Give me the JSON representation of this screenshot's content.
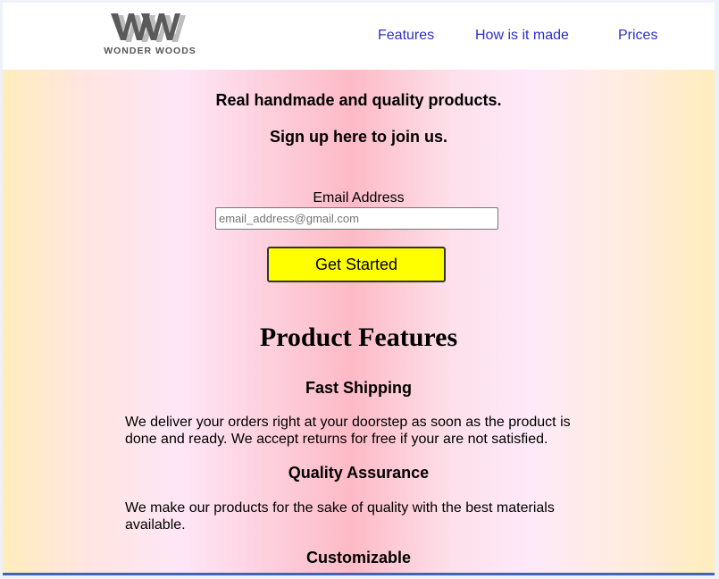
{
  "header": {
    "logo_text": "WONDER WOODS",
    "logo_monogram": "WW",
    "nav": [
      {
        "label": "Features"
      },
      {
        "label": "How is it made"
      },
      {
        "label": "Prices"
      }
    ]
  },
  "hero": {
    "tagline": "Real handmade and quality products.",
    "signup_text": "Sign up here to join us."
  },
  "form": {
    "email_label": "Email Address",
    "email_placeholder": "email_address@gmail.com",
    "submit_label": "Get Started"
  },
  "features": {
    "title": "Product Features",
    "items": [
      {
        "heading": "Fast Shipping",
        "text": "We deliver your orders right at your doorstep as soon as the product is done and ready. We accept returns for free if your are not satisfied."
      },
      {
        "heading": "Quality Assurance",
        "text": "We make our products for the sake of quality with the best materials available."
      },
      {
        "heading": "Customizable",
        "text": ""
      }
    ]
  },
  "colors": {
    "nav_link": "#2e2ec8",
    "button_bg": "#ffff00",
    "bottom_border": "#3f64b4"
  },
  "icons": {
    "logo": "ww-monogram-logo"
  }
}
